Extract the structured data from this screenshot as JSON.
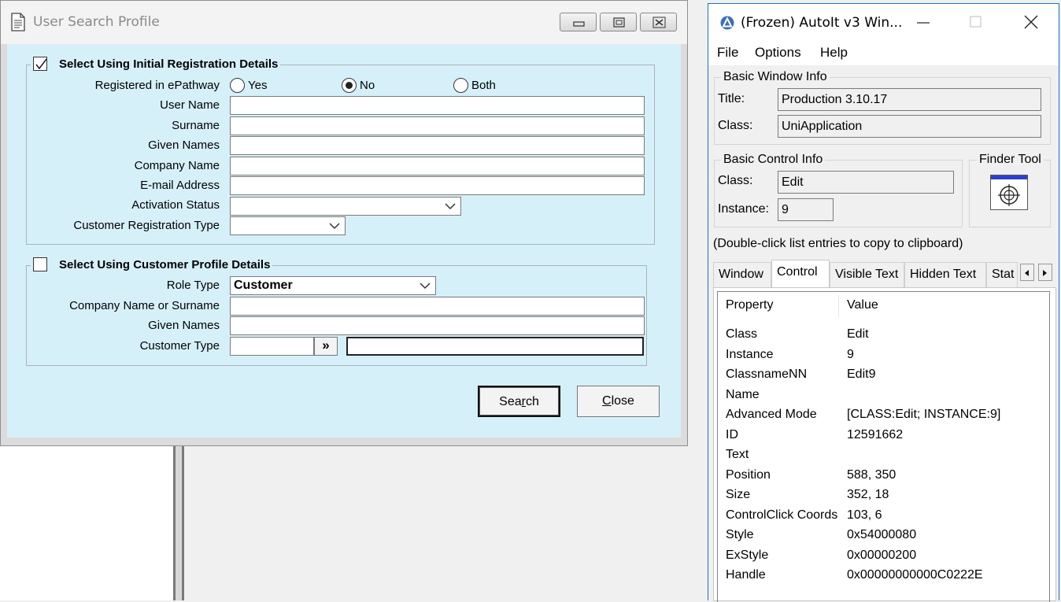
{
  "dialog": {
    "title": "User Search Profile",
    "group1": {
      "label": "Select Using Initial Registration Details",
      "checked": true,
      "registered_label": "Registered in ePathway",
      "radio_options": [
        "Yes",
        "No",
        "Both"
      ],
      "radio_selected": "No",
      "fields": {
        "user_name": "User Name",
        "surname": "Surname",
        "given_names": "Given Names",
        "company_name": "Company Name",
        "email": "E-mail Address",
        "activation_status": "Activation Status",
        "customer_registration_type": "Customer Registration Type"
      }
    },
    "group2": {
      "label": "Select Using Customer Profile Details",
      "checked": false,
      "role_type_label": "Role Type",
      "role_type_value": "Customer",
      "company_or_surname": "Company Name or Surname",
      "given_names": "Given Names",
      "customer_type": "Customer Type",
      "lookup_button": "»"
    },
    "buttons": {
      "search_pre": "Sea",
      "search_hot": "r",
      "search_post": "ch",
      "close_hot": "C",
      "close_post": "lose"
    }
  },
  "autoit": {
    "title": "(Frozen) AutoIt v3 Win...",
    "menu": [
      "File",
      "Options",
      "Help"
    ],
    "basic_window_info": {
      "label": "Basic Window Info",
      "title_label": "Title:",
      "title_value": "Production 3.10.17",
      "class_label": "Class:",
      "class_value": "UniApplication"
    },
    "basic_control_info": {
      "label": "Basic Control Info",
      "class_label": "Class:",
      "class_value": "Edit",
      "instance_label": "Instance:",
      "instance_value": "9"
    },
    "finder_tool": "Finder Tool",
    "hint": "(Double-click list entries to copy to clipboard)",
    "tabs": [
      "Window",
      "Control",
      "Visible Text",
      "Hidden Text",
      "Stat"
    ],
    "active_tab": "Control",
    "list_headers": [
      "Property",
      "Value"
    ],
    "rows": [
      {
        "property": "Class",
        "value": "Edit"
      },
      {
        "property": "Instance",
        "value": "9"
      },
      {
        "property": "ClassnameNN",
        "value": "Edit9"
      },
      {
        "property": "Name",
        "value": ""
      },
      {
        "property": "Advanced Mode",
        "value": "[CLASS:Edit; INSTANCE:9]"
      },
      {
        "property": "ID",
        "value": "12591662"
      },
      {
        "property": "Text",
        "value": ""
      },
      {
        "property": "Position",
        "value": "588, 350"
      },
      {
        "property": "Size",
        "value": "352, 18"
      },
      {
        "property": "ControlClick Coords",
        "value": "103, 6"
      },
      {
        "property": "Style",
        "value": "0x54000080"
      },
      {
        "property": "ExStyle",
        "value": "0x00000200"
      },
      {
        "property": "Handle",
        "value": "0x00000000000C0222E"
      }
    ]
  }
}
